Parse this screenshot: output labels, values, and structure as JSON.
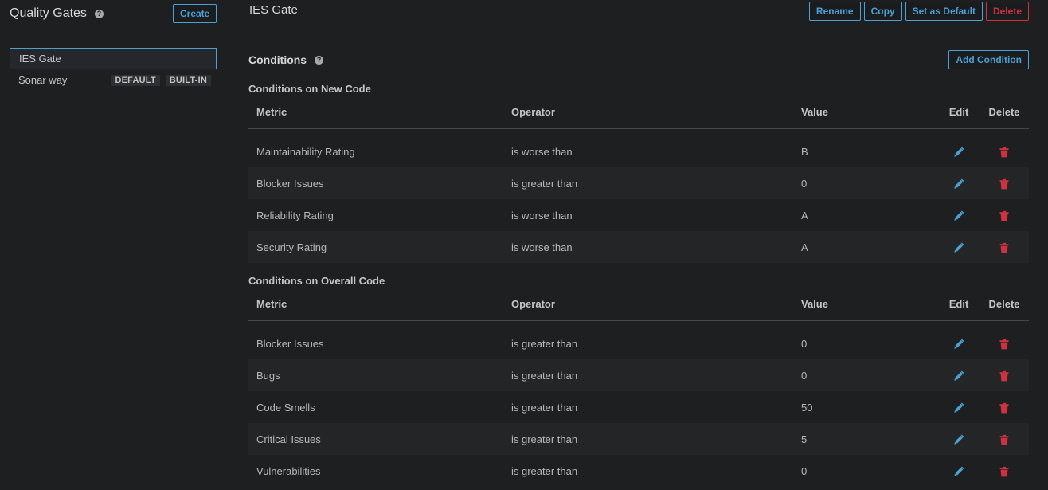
{
  "sidebar": {
    "title": "Quality Gates",
    "create_label": "Create",
    "gates": [
      {
        "name": "IES Gate",
        "badges": []
      },
      {
        "name": "Sonar way",
        "badges": [
          "DEFAULT",
          "BUILT-IN"
        ]
      }
    ]
  },
  "gate": {
    "title": "IES Gate",
    "actions": {
      "rename": "Rename",
      "copy": "Copy",
      "set_default": "Set as Default",
      "delete": "Delete"
    }
  },
  "conditions": {
    "title": "Conditions",
    "add_label": "Add Condition",
    "columns": {
      "metric": "Metric",
      "operator": "Operator",
      "value": "Value",
      "edit": "Edit",
      "delete": "Delete"
    },
    "new_code": {
      "title": "Conditions on New Code",
      "rows": [
        {
          "metric": "Maintainability Rating",
          "operator": "is worse than",
          "value": "B"
        },
        {
          "metric": "Blocker Issues",
          "operator": "is greater than",
          "value": "0"
        },
        {
          "metric": "Reliability Rating",
          "operator": "is worse than",
          "value": "A"
        },
        {
          "metric": "Security Rating",
          "operator": "is worse than",
          "value": "A"
        }
      ]
    },
    "overall_code": {
      "title": "Conditions on Overall Code",
      "rows": [
        {
          "metric": "Blocker Issues",
          "operator": "is greater than",
          "value": "0"
        },
        {
          "metric": "Bugs",
          "operator": "is greater than",
          "value": "0"
        },
        {
          "metric": "Code Smells",
          "operator": "is greater than",
          "value": "50"
        },
        {
          "metric": "Critical Issues",
          "operator": "is greater than",
          "value": "5"
        },
        {
          "metric": "Vulnerabilities",
          "operator": "is greater than",
          "value": "0"
        }
      ]
    }
  },
  "colors": {
    "accent": "#4b9fd5",
    "danger": "#d0313f",
    "background": "#1e1f21"
  },
  "icons": {
    "help": "help-icon",
    "edit": "pencil-icon",
    "delete": "trash-icon"
  }
}
